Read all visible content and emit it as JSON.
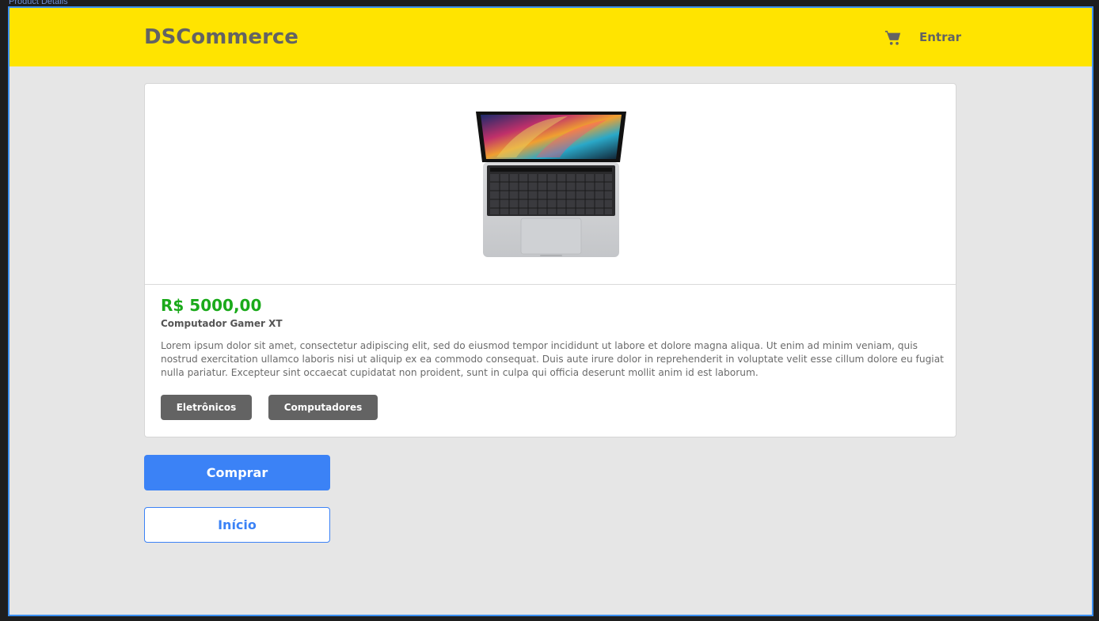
{
  "frame": {
    "label": "Product Details"
  },
  "header": {
    "brand": "DSCommerce",
    "cart_icon": "cart-icon",
    "login_label": "Entrar"
  },
  "product": {
    "image_icon": "laptop-image",
    "price": "R$ 5000,00",
    "name": "Computador Gamer XT",
    "description": "Lorem ipsum dolor sit amet, consectetur adipiscing elit, sed do eiusmod tempor incididunt ut labore et dolore magna aliqua. Ut enim ad minim veniam, quis nostrud exercitation ullamco laboris nisi ut aliquip ex ea commodo consequat. Duis aute irure dolor in reprehenderit in voluptate velit esse cillum dolore eu fugiat nulla pariatur. Excepteur sint occaecat cupidatat non proident, sunt in culpa qui officia deserunt mollit anim id est laborum.",
    "categories": [
      "Eletrônicos",
      "Computadores"
    ]
  },
  "actions": {
    "buy_label": "Comprar",
    "home_label": "Início"
  },
  "colors": {
    "header_bg": "#ffe400",
    "price": "#1aaa1a",
    "primary": "#3b82f6",
    "tag_bg": "#636363",
    "page_bg": "#e6e6e6"
  }
}
